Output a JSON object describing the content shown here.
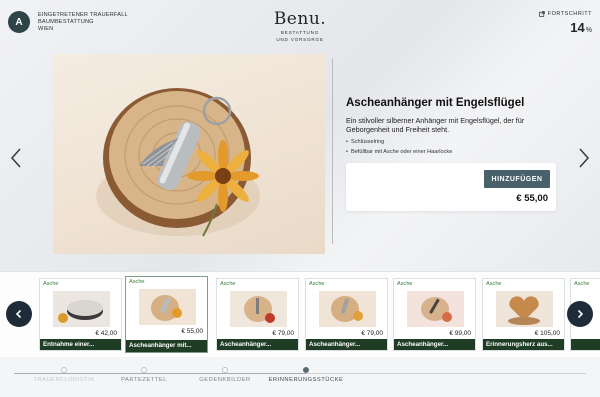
{
  "header": {
    "avatar_initial": "A",
    "case_lines": [
      "EINGETRETENER TRAUERFALL",
      "BAUMBESTATTUNG",
      "WIEN"
    ],
    "logo": "Benu.",
    "logo_sub_lines": [
      "BESTATTUNG",
      "UND VORSORGE"
    ],
    "progress_label": "FORTSCHRITT",
    "progress_value": "14",
    "progress_unit": "%"
  },
  "product": {
    "title": "Ascheanhänger mit Engelsflügel",
    "description": "Ein stilvoller silberner Anhänger mit Engelsflügel, der für Geborgenheit und Freiheit steht.",
    "features": [
      "Schlüsselring",
      "Befüllbar mit Asche oder einer Haarlocke"
    ],
    "add_button": "HINZUFÜGEN",
    "price": "€ 55,00"
  },
  "carousel": {
    "items": [
      {
        "category": "Asche",
        "price": "€ 42,00",
        "name": "Entnahme einer...",
        "selected": false
      },
      {
        "category": "Asche",
        "price": "€ 55,00",
        "name": "Ascheanhänger mit...",
        "selected": true
      },
      {
        "category": "Asche",
        "price": "€ 79,00",
        "name": "Ascheanhänger...",
        "selected": false
      },
      {
        "category": "Asche",
        "price": "€ 79,00",
        "name": "Ascheanhänger...",
        "selected": false
      },
      {
        "category": "Asche",
        "price": "€ 99,00",
        "name": "Ascheanhänger...",
        "selected": false
      },
      {
        "category": "Asche",
        "price": "€ 105,00",
        "name": "Erinnerungsherz aus...",
        "selected": false
      },
      {
        "category": "Asche",
        "price": "",
        "name": "",
        "selected": false
      }
    ]
  },
  "steps": [
    {
      "label": "TRAUERFLORISTIK",
      "state": "faded"
    },
    {
      "label": "PARTEZETTEL",
      "state": "done"
    },
    {
      "label": "GEDENKBILDER",
      "state": "done"
    },
    {
      "label": "ERINNERUNGSSTÜCKE",
      "state": "active"
    }
  ],
  "icons": {
    "prev": "chevron-left-icon",
    "next": "chevron-right-icon",
    "progress": "external-link-icon"
  },
  "colors": {
    "accent": "#48616b",
    "category": "#3b7d3b",
    "name_bar": "#1f3d24",
    "nav_round": "#1f2b39"
  }
}
